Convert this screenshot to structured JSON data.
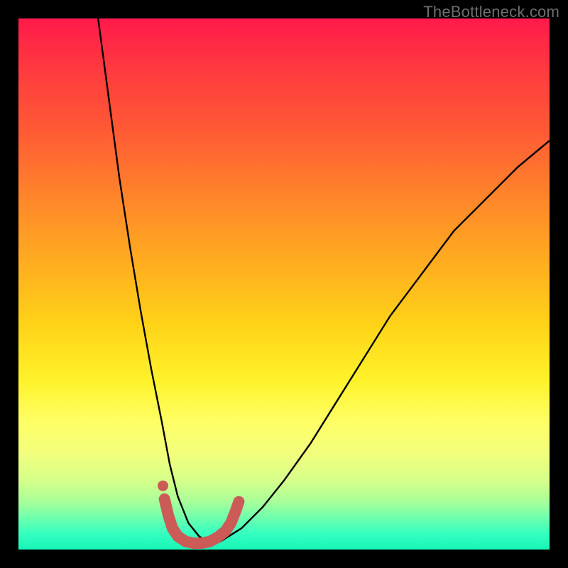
{
  "watermark": "TheBottleneck.com",
  "chart_data": {
    "type": "line",
    "title": "",
    "xlabel": "",
    "ylabel": "",
    "xlim": [
      0,
      100
    ],
    "ylim": [
      0,
      100
    ],
    "series": [
      {
        "name": "black-curve",
        "x": [
          15,
          17,
          19,
          21,
          23,
          25,
          27,
          28.5,
          30,
          32,
          34,
          36,
          38,
          42,
          46,
          50,
          55,
          60,
          65,
          70,
          76,
          82,
          88,
          94,
          100
        ],
        "y": [
          100,
          85,
          70,
          57,
          45,
          34,
          24,
          16,
          10,
          5,
          2.5,
          1.2,
          1.5,
          4,
          8,
          13,
          20,
          28,
          36,
          44,
          52,
          60,
          66,
          72,
          77
        ]
      },
      {
        "name": "red-marker-curve",
        "x": [
          27.5,
          28.2,
          29,
          30,
          31.5,
          33,
          34.5,
          36,
          37.5,
          39,
          40,
          40.8,
          41.5
        ],
        "y": [
          9.5,
          6.5,
          4,
          2.5,
          1.5,
          1.2,
          1.2,
          1.5,
          2.3,
          3.5,
          5,
          7,
          9
        ],
        "marker_dot": {
          "x": 27.2,
          "y": 12
        }
      }
    ],
    "colors": {
      "black_curve": "#000000",
      "red_marker": "#cc5a56",
      "gradient_top": "#ff1a4a",
      "gradient_bottom": "#18f5b8"
    }
  }
}
